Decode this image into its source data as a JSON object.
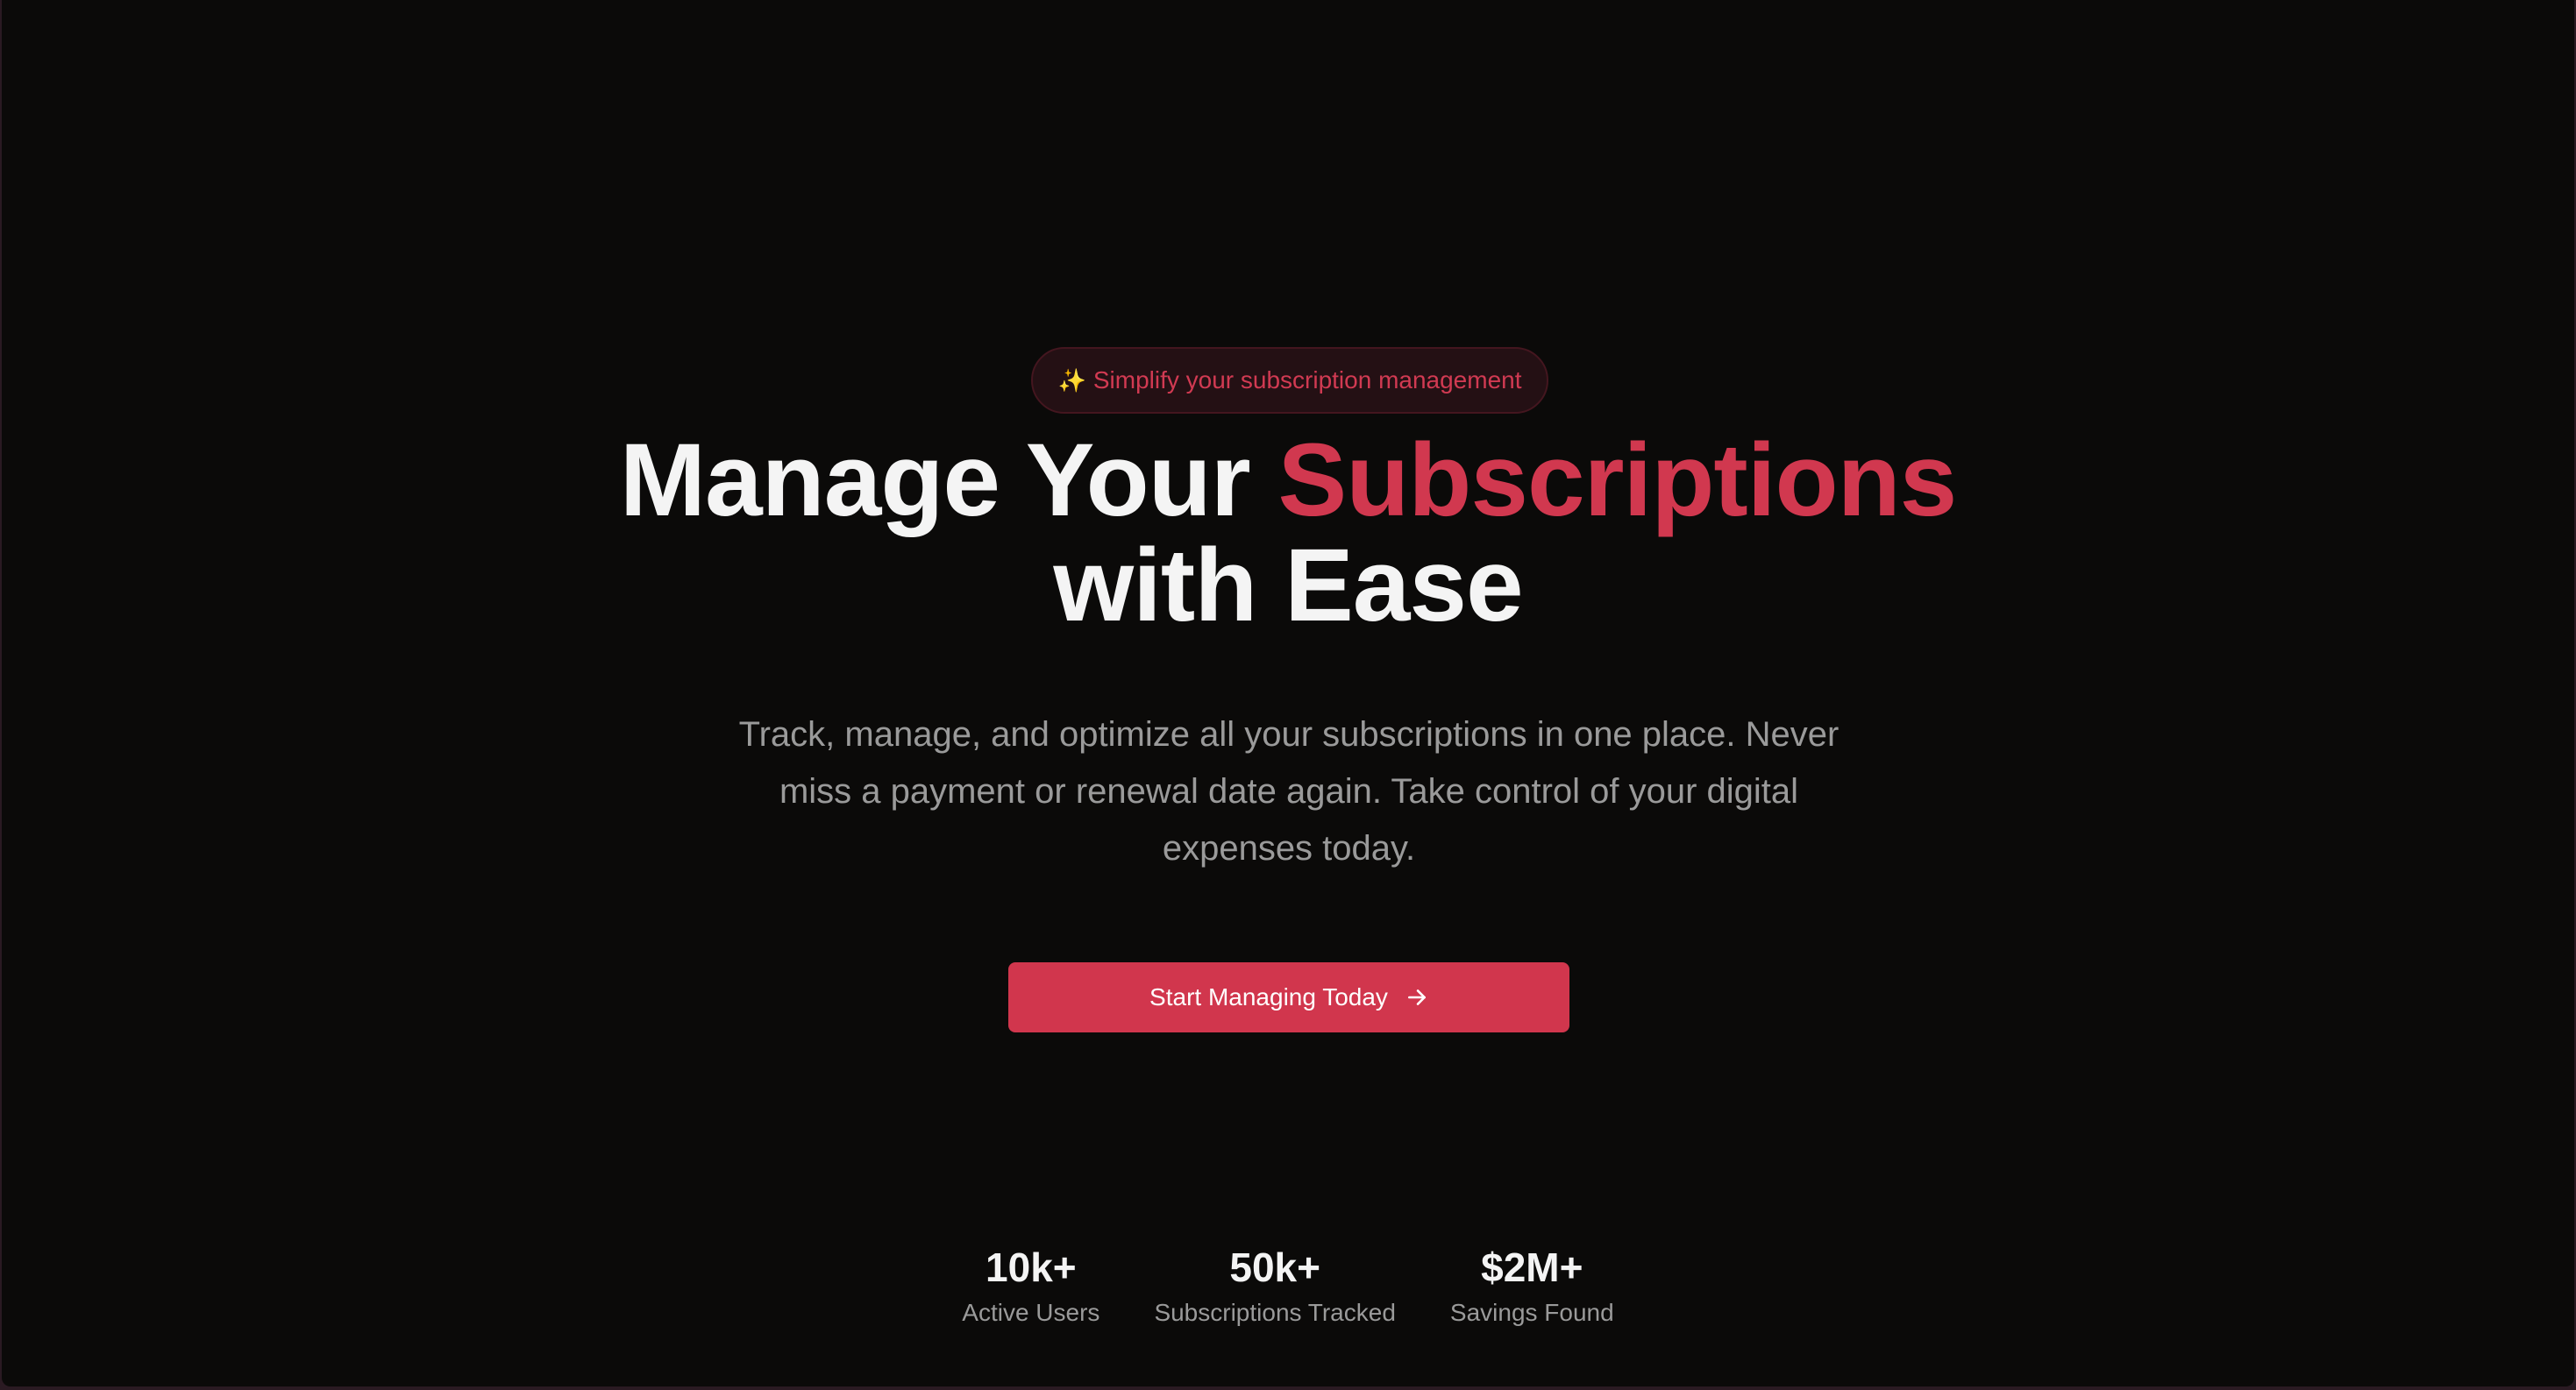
{
  "hero": {
    "badge": {
      "icon": "sparkles-icon",
      "icon_glyph": "✨",
      "text": "Simplify your subscription management"
    },
    "headline": {
      "part1": "Manage Your ",
      "accent": "Subscriptions",
      "part2": "with Ease"
    },
    "subtitle": "Track, manage, and optimize all your subscriptions in one place. Never miss a payment or renewal date again. Take control of your digital expenses today.",
    "cta": {
      "label": "Start Managing Today",
      "icon": "arrow-right-icon"
    }
  },
  "stats": [
    {
      "value": "10k+",
      "label": "Active Users"
    },
    {
      "value": "50k+",
      "label": "Subscriptions Tracked"
    },
    {
      "value": "$2M+",
      "label": "Savings Found"
    }
  ],
  "colors": {
    "background": "#0b0a09",
    "accent": "#d1384f",
    "text_primary": "#f4f4f4",
    "text_muted": "#9a9a9a"
  }
}
